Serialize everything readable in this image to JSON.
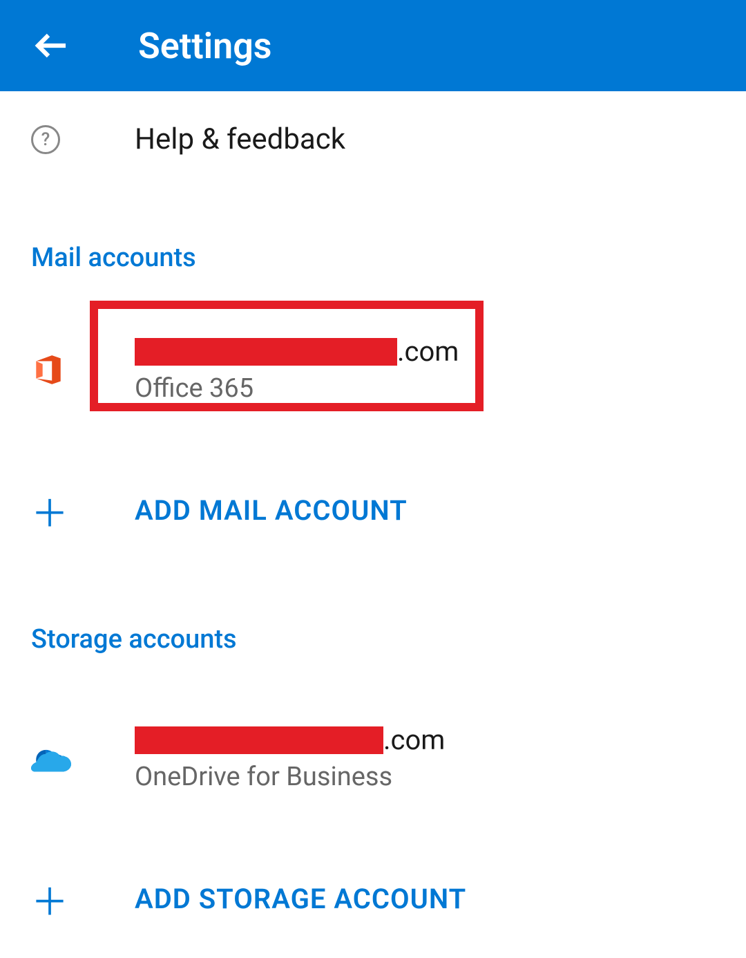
{
  "header": {
    "title": "Settings"
  },
  "help": {
    "label": "Help & feedback"
  },
  "mail": {
    "section_title": "Mail accounts",
    "account": {
      "email_suffix": ".com",
      "type": "Office 365"
    },
    "add_label": "ADD MAIL ACCOUNT"
  },
  "storage": {
    "section_title": "Storage accounts",
    "account": {
      "email_suffix": ".com",
      "type": "OneDrive for Business"
    },
    "add_label": "ADD STORAGE ACCOUNT"
  }
}
